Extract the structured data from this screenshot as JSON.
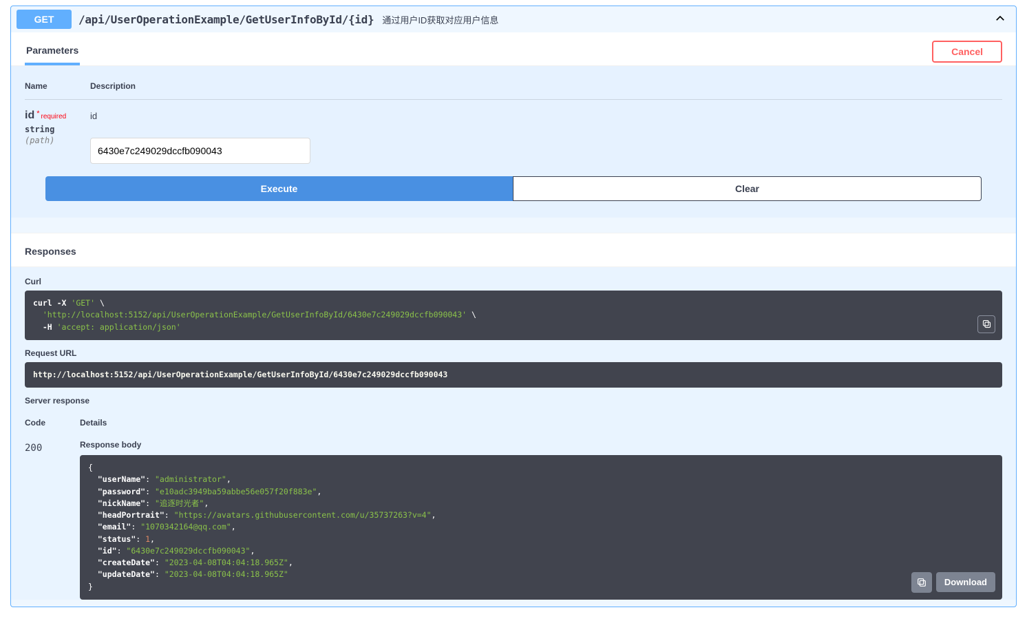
{
  "header": {
    "method": "GET",
    "path": "/api/UserOperationExample/GetUserInfoById/{id}",
    "summary": "通过用户ID获取对应用户信息"
  },
  "tabs": {
    "parameters": "Parameters",
    "cancel": "Cancel"
  },
  "param_headers": {
    "name": "Name",
    "desc": "Description"
  },
  "param": {
    "name": "id",
    "required_label": "required",
    "type": "string",
    "in": "(path)",
    "desc": "id",
    "value": "6430e7c249029dccfb090043"
  },
  "buttons": {
    "execute": "Execute",
    "clear": "Clear",
    "download": "Download"
  },
  "responses_title": "Responses",
  "curl_label": "Curl",
  "curl": {
    "l1a": "curl -X ",
    "l1b": "'GET'",
    "l1c": " \\",
    "l2a": "  ",
    "l2b": "'http://localhost:5152/api/UserOperationExample/GetUserInfoById/6430e7c249029dccfb090043'",
    "l2c": " \\",
    "l3a": "  -H ",
    "l3b": "'accept: application/json'"
  },
  "request_url_label": "Request URL",
  "request_url": "http://localhost:5152/api/UserOperationExample/GetUserInfoById/6430e7c249029dccfb090043",
  "server_response_label": "Server response",
  "resp_headers": {
    "code": "Code",
    "details": "Details"
  },
  "response": {
    "code": "200",
    "body_label": "Response body"
  },
  "json_body": {
    "userName": "administrator",
    "password": "e10adc3949ba59abbe56e057f20f883e",
    "nickName": "追逐时光者",
    "headPortrait": "https://avatars.githubusercontent.com/u/35737263?v=4",
    "email": "1070342164@qq.com",
    "status": 1,
    "id": "6430e7c249029dccfb090043",
    "createDate": "2023-04-08T04:04:18.965Z",
    "updateDate": "2023-04-08T04:04:18.965Z"
  }
}
